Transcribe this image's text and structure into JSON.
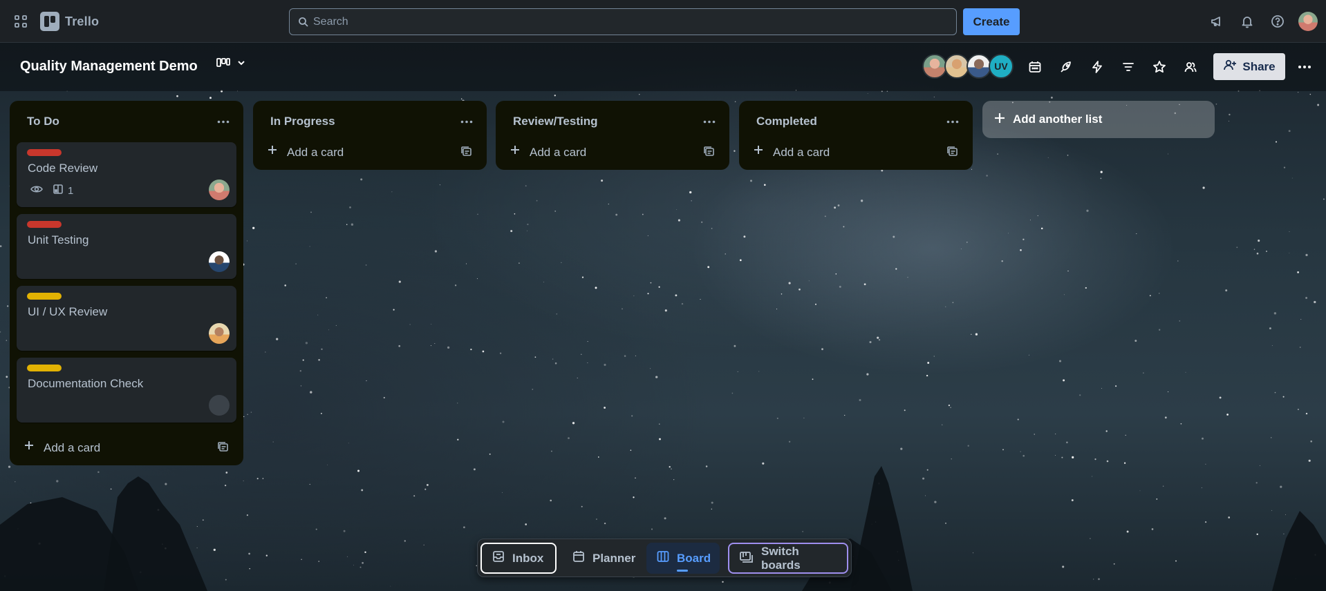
{
  "topbar": {
    "app_name": "Trello",
    "search_placeholder": "Search",
    "create_label": "Create",
    "icons": [
      "apps-grid-icon",
      "megaphone-icon",
      "bell-icon",
      "help-icon",
      "profile-avatar"
    ]
  },
  "board": {
    "title": "Quality Management Demo",
    "view_icon": "board-view-icon",
    "members": [
      "member-photo",
      "member-photo",
      "member-photo",
      "UV"
    ],
    "member_initials": "UV",
    "toolbar_icons": [
      "calendar-icon",
      "power-ups-icon",
      "automation-icon",
      "filter-icon",
      "star-icon",
      "visibility-icon"
    ],
    "share_label": "Share"
  },
  "lists": [
    {
      "title": "To Do",
      "cards": [
        {
          "title": "Code Review",
          "label_color": "#c9372c",
          "badges": {
            "watching": true,
            "checklist_count": "1"
          }
        },
        {
          "title": "Unit Testing",
          "label_color": "#c9372c"
        },
        {
          "title": "UI / UX Review",
          "label_color": "#e2b203"
        },
        {
          "title": "Documentation Check",
          "label_color": "#e2b203"
        }
      ],
      "add_card_label": "Add a card"
    },
    {
      "title": "In Progress",
      "cards": [],
      "add_card_label": "Add a card"
    },
    {
      "title": "Review/Testing",
      "cards": [],
      "add_card_label": "Add a card"
    },
    {
      "title": "Completed",
      "cards": [],
      "add_card_label": "Add a card"
    }
  ],
  "add_list_label": "Add another list",
  "switcher": {
    "inbox": "Inbox",
    "planner": "Planner",
    "board": "Board",
    "switch_boards": "Switch boards",
    "active": "Board"
  },
  "colors": {
    "accent": "#579dff",
    "label_red": "#c9372c",
    "label_yellow": "#e2b203",
    "list_bg": "#101204",
    "card_bg": "#22272b"
  }
}
